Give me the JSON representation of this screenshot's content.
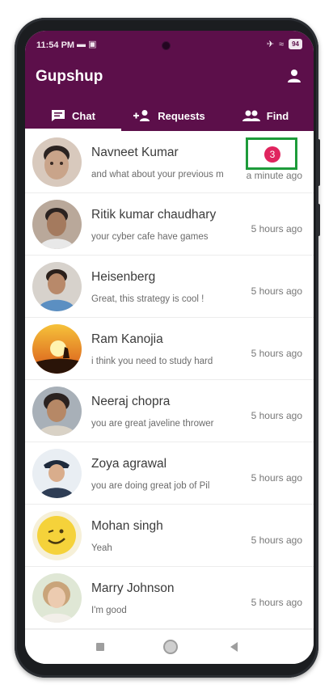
{
  "status_bar": {
    "time": "11:54 PM",
    "battery": "94"
  },
  "app": {
    "title": "Gupshup"
  },
  "tabs": [
    {
      "label": "Chat",
      "icon": "chat-icon",
      "active": true
    },
    {
      "label": "Requests",
      "icon": "add-person-icon",
      "active": false
    },
    {
      "label": "Find",
      "icon": "people-icon",
      "active": false
    }
  ],
  "chats": [
    {
      "name": "Navneet Kumar",
      "message": "and what about your previous m",
      "time": "a minute ago",
      "unread": "3",
      "avatar_color": "#c9a48a"
    },
    {
      "name": "Ritik kumar chaudhary",
      "message": "your cyber cafe have games",
      "time": "5 hours ago",
      "avatar_color": "#7a5a45"
    },
    {
      "name": "Heisenberg",
      "message": "Great, this strategy is cool !",
      "time": "5 hours ago",
      "avatar_color": "#5b8fc2"
    },
    {
      "name": "Ram Kanojia",
      "message": "i think you need to study hard",
      "time": "5 hours ago",
      "avatar_color": "#f29a1d"
    },
    {
      "name": "Neeraj chopra",
      "message": "you are great javeline thrower",
      "time": "5 hours ago",
      "avatar_color": "#8e7a6a"
    },
    {
      "name": "Zoya agrawal",
      "message": "you are doing great job of Pil",
      "time": "5 hours ago",
      "avatar_color": "#2e3d55"
    },
    {
      "name": "Mohan singh",
      "message": "Yeah",
      "time": "5 hours ago",
      "avatar_color": "#f5d23a"
    },
    {
      "name": "Marry Johnson",
      "message": "I'm good",
      "time": "5 hours ago",
      "avatar_color": "#d9b79a"
    }
  ],
  "colors": {
    "appbar": "#5c0f4a",
    "badge": "#e0245e",
    "highlight_box": "#1d9b3a"
  }
}
